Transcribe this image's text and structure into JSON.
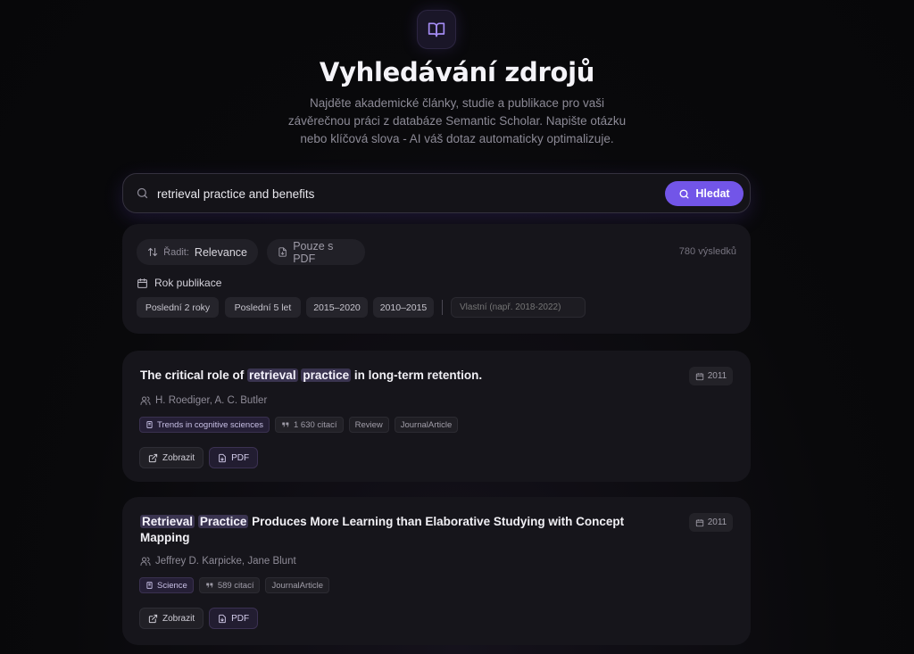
{
  "header": {
    "logo_icon": "book-open-icon",
    "title": "Vyhledávání zdrojů",
    "subtitle_line1": "Najděte akademické články, studie a publikace pro vaši",
    "subtitle_line2": "závěrečnou práci z databáze Semantic Scholar. Napište otázku",
    "subtitle_line3": "nebo klíčová slova - AI váš dotaz automaticky optimalizuje."
  },
  "search": {
    "value": "retrieval practice and benefits",
    "button_label": "Hledat",
    "accent_color": "#7255e8"
  },
  "filters": {
    "sort_label": "Řadit:",
    "sort_value": "Relevance",
    "pdf_only_label": "Pouze s PDF",
    "results_count": "780 výsledků",
    "year_label": "Rok publikace",
    "year_chips": [
      "Poslední 2 roky",
      "Poslední 5 let",
      "2015–2020",
      "2010–2015"
    ],
    "custom_placeholder": "Vlastní (např. 2018-2022)"
  },
  "results": [
    {
      "title_pre": "The critical role of ",
      "hl1": "retrieval",
      "hl2": "practice",
      "title_post": " in long-term retention.",
      "year": "2011",
      "authors": "H. Roediger, A. C. Butler",
      "journal": "Trends in cognitive sciences",
      "citations": "1 630 citací",
      "tags": [
        "Review",
        "JournalArticle"
      ],
      "view_label": "Zobrazit",
      "pdf_label": "PDF"
    },
    {
      "hl1": "Retrieval",
      "hl2": "Practice",
      "title_line1_post": " Produces More Learning than Elaborative Studying with Concept",
      "title_line2": "Mapping",
      "year": "2011",
      "authors": "Jeffrey D. Karpicke, Jane Blunt",
      "journal": "Science",
      "citations": "589 citací",
      "tags": [
        "JournalArticle"
      ],
      "view_label": "Zobrazit",
      "pdf_label": "PDF"
    }
  ]
}
